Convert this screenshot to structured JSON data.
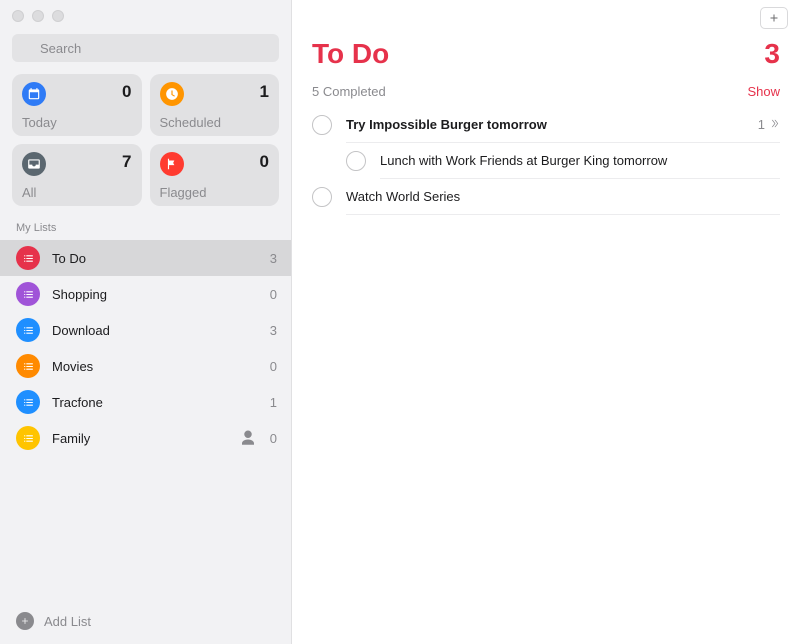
{
  "search": {
    "placeholder": "Search"
  },
  "smartLists": {
    "today": {
      "label": "Today",
      "count": 0,
      "color": "#2f7bf6"
    },
    "scheduled": {
      "label": "Scheduled",
      "count": 1,
      "color": "#ff9500"
    },
    "all": {
      "label": "All",
      "count": 7,
      "color": "#5b6770"
    },
    "flagged": {
      "label": "Flagged",
      "count": 0,
      "color": "#ff3b30"
    }
  },
  "sidebar": {
    "section": "My Lists",
    "lists": [
      {
        "name": "To Do",
        "count": 3,
        "color": "#e6324b",
        "selected": true,
        "shared": false
      },
      {
        "name": "Shopping",
        "count": 0,
        "color": "#a054d8",
        "selected": false,
        "shared": false
      },
      {
        "name": "Download",
        "count": 3,
        "color": "#1f8fff",
        "selected": false,
        "shared": false
      },
      {
        "name": "Movies",
        "count": 0,
        "color": "#ff8a00",
        "selected": false,
        "shared": false
      },
      {
        "name": "Tracfone",
        "count": 1,
        "color": "#1f8fff",
        "selected": false,
        "shared": false
      },
      {
        "name": "Family",
        "count": 0,
        "color": "#ffc400",
        "selected": false,
        "shared": true
      }
    ],
    "addList": "Add List"
  },
  "main": {
    "title": "To Do",
    "count": 3,
    "completed": {
      "label": "5 Completed",
      "action": "Show"
    },
    "reminders": [
      {
        "title": "Try Impossible Burger tomorrow",
        "bold": true,
        "subCount": 1
      },
      {
        "title": "Lunch with Work Friends at Burger King tomorrow",
        "sub": true
      },
      {
        "title": "Watch World Series"
      }
    ]
  }
}
